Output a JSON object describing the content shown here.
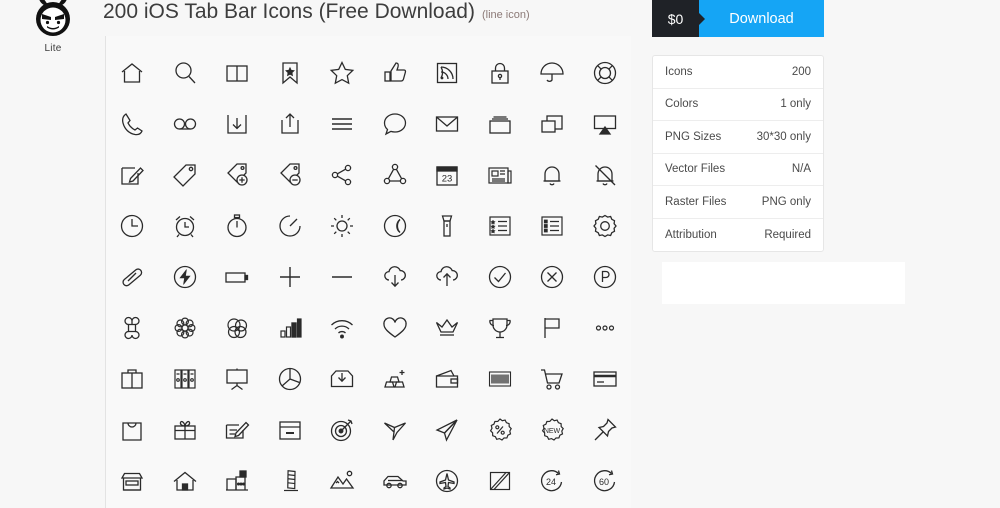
{
  "brand": {
    "name": "Lite",
    "logo_icon": "devil-face-logo"
  },
  "header": {
    "title": "200 iOS Tab Bar Icons (Free Download)",
    "subtitle": "(line icon)"
  },
  "download": {
    "price": "$0",
    "label": "Download",
    "price_bg": "#1f2227",
    "button_bg": "#15a5f5"
  },
  "info_table": {
    "rows": [
      {
        "label": "Icons",
        "value": "200"
      },
      {
        "label": "Colors",
        "value": "1 only"
      },
      {
        "label": "PNG Sizes",
        "value": "30*30 only"
      },
      {
        "label": "Vector Files",
        "value": "N/A"
      },
      {
        "label": "Raster Files",
        "value": "PNG only"
      },
      {
        "label": "Attribution",
        "value": "Required"
      }
    ]
  },
  "icon_grid": {
    "columns": 10,
    "rows": 9,
    "icons": [
      "home-icon",
      "search-icon",
      "book-icon",
      "bookmark-star-icon",
      "star-icon",
      "thumbs-up-icon",
      "rss-icon",
      "lock-icon",
      "umbrella-icon",
      "lifebuoy-icon",
      "phone-icon",
      "voicemail-icon",
      "download-box-icon",
      "share-up-icon",
      "menu-lines-icon",
      "chat-bubble-icon",
      "mail-envelope-icon",
      "folder-icon",
      "windows-stack-icon",
      "airplay-icon",
      "compose-icon",
      "tag-icon",
      "tag-add-icon",
      "tag-remove-icon",
      "share-node-icon",
      "share-network-icon",
      "calendar-23-icon",
      "news-icon",
      "bell-icon",
      "bell-off-icon",
      "clock-icon",
      "alarm-clock-icon",
      "stopwatch-icon",
      "timer-icon",
      "sun-icon",
      "moon-icon",
      "flashlight-icon",
      "list-star-icon",
      "list-bullet-icon",
      "gear-icon",
      "bandage-icon",
      "flash-circle-icon",
      "battery-icon",
      "plus-icon",
      "minus-icon",
      "cloud-download-icon",
      "cloud-upload-icon",
      "check-circle-icon",
      "x-circle-icon",
      "parking-circle-icon",
      "command-icon",
      "flower-icon",
      "circles-overlap-icon",
      "signal-bars-icon",
      "wifi-icon",
      "heart-icon",
      "crown-icon",
      "trophy-icon",
      "flag-icon",
      "more-dots-icon",
      "briefcase-icon",
      "binders-icon",
      "presentation-icon",
      "pie-chart-icon",
      "inbox-icon",
      "gold-bars-icon",
      "wallet-icon",
      "barcode-icon",
      "shopping-cart-icon",
      "credit-card-icon",
      "shopping-bag-icon",
      "gift-icon",
      "sign-document-icon",
      "archive-box-icon",
      "target-icon",
      "origami-bird-icon",
      "paper-plane-icon",
      "percent-badge-icon",
      "new-badge-icon",
      "pin-icon",
      "shop-icon",
      "house-icon",
      "factory-icon",
      "tower-icon",
      "mountains-icon",
      "car-icon",
      "airplane-circle-icon",
      "road-sign-icon",
      "24-circle-icon",
      "60-circle-icon"
    ],
    "badge_labels": {
      "calendar": "23",
      "new_badge": "NEW",
      "hours_24": "24",
      "minutes_60": "60"
    }
  }
}
